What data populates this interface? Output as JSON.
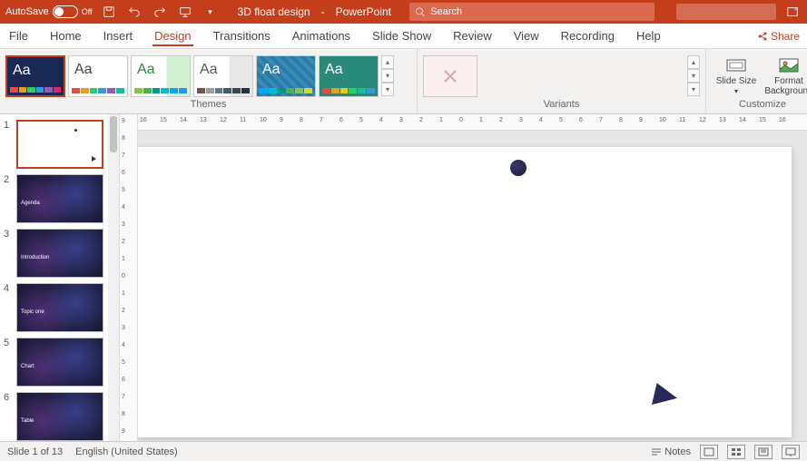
{
  "titlebar": {
    "autosave_label": "AutoSave",
    "autosave_state": "Off",
    "doc_name": "3D float design",
    "app_name": "PowerPoint",
    "search_placeholder": "Search"
  },
  "tabs": {
    "file": "File",
    "home": "Home",
    "insert": "Insert",
    "design": "Design",
    "transitions": "Transitions",
    "animations": "Animations",
    "slideshow": "Slide Show",
    "review": "Review",
    "view": "View",
    "recording": "Recording",
    "help": "Help",
    "share": "Share"
  },
  "ribbon": {
    "themes_label": "Themes",
    "variants_label": "Variants",
    "customize_label": "Customize",
    "slide_size": "Slide Size",
    "format_bg": "Format Background",
    "themes": [
      {
        "bg": "#1a2855",
        "aa_color": "#ffffff",
        "colors": [
          "#e74c3c",
          "#f39c12",
          "#2ecc71",
          "#3498db",
          "#9b59b6",
          "#e91e63"
        ]
      },
      {
        "bg": "#ffffff",
        "aa_color": "#444444",
        "colors": [
          "#e74c3c",
          "#f39c12",
          "#2ecc71",
          "#3498db",
          "#9b59b6",
          "#1abc9c"
        ]
      },
      {
        "bg": "#ffffff",
        "aa_color": "#2a8a3a",
        "accent_bg": "#d4f0d4",
        "colors": [
          "#8bc34a",
          "#4caf50",
          "#009688",
          "#00bcd4",
          "#03a9f4",
          "#2196f3"
        ]
      },
      {
        "bg": "#ffffff",
        "aa_color": "#555555",
        "accent_bg": "#e8e8e8",
        "colors": [
          "#795548",
          "#9e9e9e",
          "#607d8b",
          "#455a64",
          "#37474f",
          "#263238"
        ]
      },
      {
        "bg": "#2a7aa8",
        "pattern": true,
        "aa_color": "#ffffff",
        "colors": [
          "#03a9f4",
          "#00bcd4",
          "#009688",
          "#4caf50",
          "#8bc34a",
          "#cddc39"
        ]
      },
      {
        "bg": "#2a8a7a",
        "aa_color": "#ffffff",
        "colors": [
          "#e74c3c",
          "#f39c12",
          "#f1c40f",
          "#2ecc71",
          "#1abc9c",
          "#3498db"
        ]
      }
    ]
  },
  "slides": {
    "items": [
      {
        "num": "1",
        "title": "",
        "bg": "#ffffff",
        "current": true
      },
      {
        "num": "2",
        "title": "Agenda",
        "bg": "#1a1a3a"
      },
      {
        "num": "3",
        "title": "Introduction",
        "bg": "#1a1a3a"
      },
      {
        "num": "4",
        "title": "Topic one",
        "bg": "#1a1a3a"
      },
      {
        "num": "5",
        "title": "Chart",
        "bg": "#1a1a3a"
      },
      {
        "num": "6",
        "title": "Table",
        "bg": "#1a1a3a"
      }
    ]
  },
  "ruler": {
    "h_ticks": [
      "16",
      "15",
      "14",
      "13",
      "12",
      "11",
      "10",
      "9",
      "8",
      "7",
      "6",
      "5",
      "4",
      "3",
      "2",
      "1",
      "0",
      "1",
      "2",
      "3",
      "4",
      "5",
      "6",
      "7",
      "8",
      "9",
      "10",
      "11",
      "12",
      "13",
      "14",
      "15",
      "16"
    ],
    "v_ticks": [
      "9",
      "8",
      "7",
      "6",
      "5",
      "4",
      "3",
      "2",
      "1",
      "0",
      "1",
      "2",
      "3",
      "4",
      "5",
      "6",
      "7",
      "8",
      "9"
    ]
  },
  "statusbar": {
    "slide_info": "Slide 1 of 13",
    "language": "English (United States)",
    "notes": "Notes"
  }
}
